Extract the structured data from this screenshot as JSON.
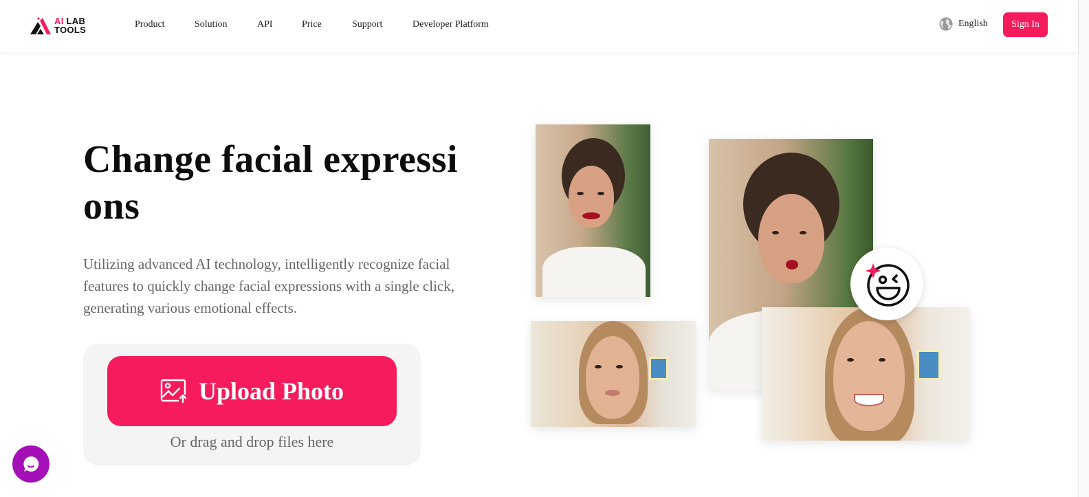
{
  "header": {
    "logo": {
      "line1_accent": "AI",
      "line1": "LAB",
      "line2": "TOOLS"
    },
    "nav": [
      {
        "label": "Product"
      },
      {
        "label": "Solution"
      },
      {
        "label": "API"
      },
      {
        "label": "Price"
      },
      {
        "label": "Support"
      },
      {
        "label": "Developer Platform"
      }
    ],
    "language": {
      "label": "English",
      "icon": "globe-icon"
    },
    "sign_in_label": "Sign In"
  },
  "hero": {
    "title": "Change facial expressions",
    "description": "Utilizing advanced AI technology, intelligently recognize facial features to quickly change facial expressions with a single click, generating various emotional effects.",
    "upload": {
      "button_label": "Upload Photo",
      "button_icon": "image-upload-icon",
      "drag_text": "Or drag and drop files here"
    }
  },
  "showcase": {
    "images": [
      {
        "name": "before-neutral-brunette"
      },
      {
        "name": "after-kiss-brunette"
      },
      {
        "name": "before-neutral-blonde"
      },
      {
        "name": "after-smile-blonde"
      }
    ],
    "badge_icon": "winking-face-icon"
  },
  "chat": {
    "icon": "chat-bubble-icon"
  },
  "colors": {
    "brand": "#f51b5c",
    "chat": "#a40fb8",
    "text_primary": "#0d0d0d",
    "text_secondary": "#666666",
    "card_bg": "#f4f4f4"
  }
}
